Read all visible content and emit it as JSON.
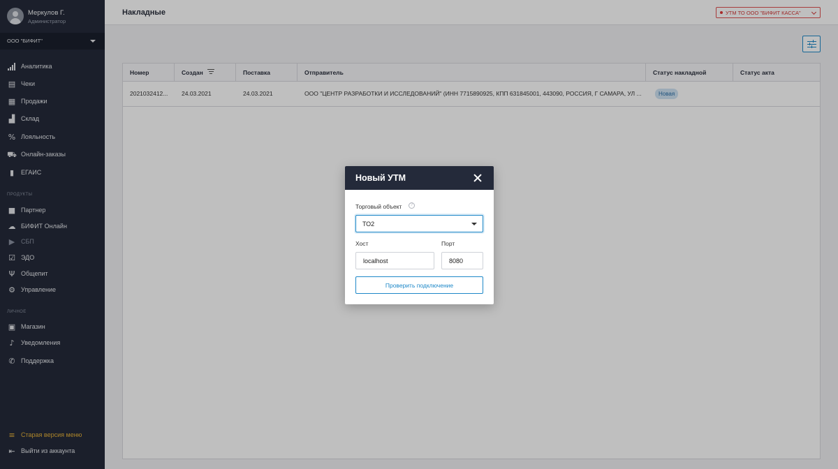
{
  "user": {
    "name": "Меркулов Г.",
    "role": "Администратор"
  },
  "org": {
    "selected": "ООО \"БИФИТ\""
  },
  "nav": {
    "main": [
      {
        "label": "Аналитика",
        "icon": "bar-chart-icon"
      },
      {
        "label": "Чеки",
        "icon": "receipt-icon"
      },
      {
        "label": "Продажи",
        "icon": "document-icon"
      },
      {
        "label": "Склад",
        "icon": "boxes-icon"
      },
      {
        "label": "Лояльность",
        "icon": "percent-icon"
      },
      {
        "label": "Онлайн-заказы",
        "icon": "cart-icon"
      },
      {
        "label": "ЕГАИС",
        "icon": "bottles-icon"
      }
    ],
    "products_title": "ПРОДУКТЫ",
    "products": [
      {
        "label": "Партнер",
        "icon": "briefcase-icon"
      },
      {
        "label": "БИФИТ Онлайн",
        "icon": "cloud-icon"
      },
      {
        "label": "СБП",
        "icon": "sbp-logo-icon"
      },
      {
        "label": "ЭДО",
        "icon": "clipboard-check-icon"
      },
      {
        "label": "Общепит",
        "icon": "fork-knife-icon"
      },
      {
        "label": "Управление",
        "icon": "people-gear-icon"
      }
    ],
    "personal_title": "ЛИЧНОЕ",
    "personal": [
      {
        "label": "Магазин",
        "icon": "store-icon"
      },
      {
        "label": "Уведомления",
        "icon": "bell-icon"
      },
      {
        "label": "Поддержка",
        "icon": "phone-icon"
      }
    ],
    "old_menu": "Старая версия меню",
    "logout": "Выйти из аккаунта"
  },
  "header": {
    "title": "Накладные",
    "utm_status": "УТМ ТО ООО \"БИФИТ КАССА\"",
    "utm_status_color": "#d23838"
  },
  "table": {
    "columns": [
      "Номер",
      "Создан",
      "Поставка",
      "Отправитель",
      "Статус накладной",
      "Статус акта"
    ],
    "rows": [
      {
        "number": "2021032412...",
        "created": "24.03.2021",
        "delivery": "24.03.2021",
        "sender": "ООО \"ЦЕНТР РАЗРАБОТКИ И ИССЛЕДОВАНИЙ\" (ИНН 7715890925, КПП 631845001, 443090, РОССИЯ, Г САМАРА, УЛ ...",
        "status": "Новая",
        "act_status": ""
      }
    ]
  },
  "modal": {
    "title": "Новый УТМ",
    "store_label": "Торговый объект",
    "store_value": "ТО2",
    "host_label": "Хост",
    "host_value": "localhost",
    "port_label": "Порт",
    "port_value": "8080",
    "check_button": "Проверить подключение"
  }
}
